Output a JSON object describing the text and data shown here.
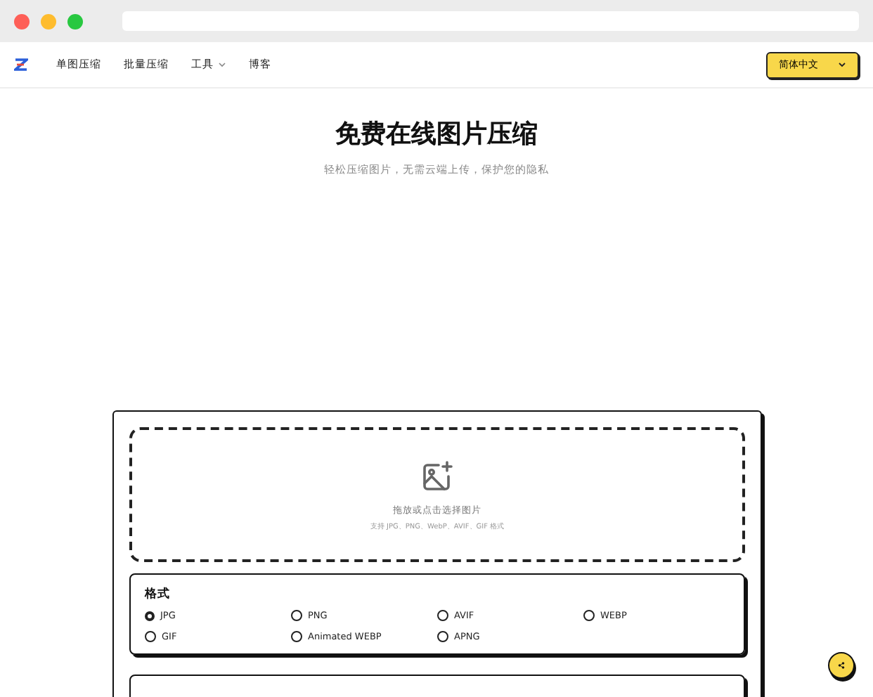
{
  "nav": {
    "items": [
      {
        "label": "单图压缩",
        "kind": "link"
      },
      {
        "label": "批量压缩",
        "kind": "link"
      },
      {
        "label": "工具",
        "kind": "dropdown"
      },
      {
        "label": "博客",
        "kind": "link"
      }
    ],
    "language": "简体中文"
  },
  "hero": {
    "title": "免费在线图片压缩",
    "subtitle": "轻松压缩图片，无需云端上传，保护您的隐私"
  },
  "dropzone": {
    "prompt": "拖放或点击选择图片",
    "hint": "支持 JPG、PNG、WebP、AVIF、GIF 格式"
  },
  "format": {
    "heading": "格式",
    "options": [
      {
        "label": "JPG",
        "selected": true
      },
      {
        "label": "PNG",
        "selected": false
      },
      {
        "label": "AVIF",
        "selected": false
      },
      {
        "label": "WEBP",
        "selected": false
      },
      {
        "label": "GIF",
        "selected": false
      },
      {
        "label": "Animated WEBP",
        "selected": false
      },
      {
        "label": "APNG",
        "selected": false
      }
    ]
  }
}
